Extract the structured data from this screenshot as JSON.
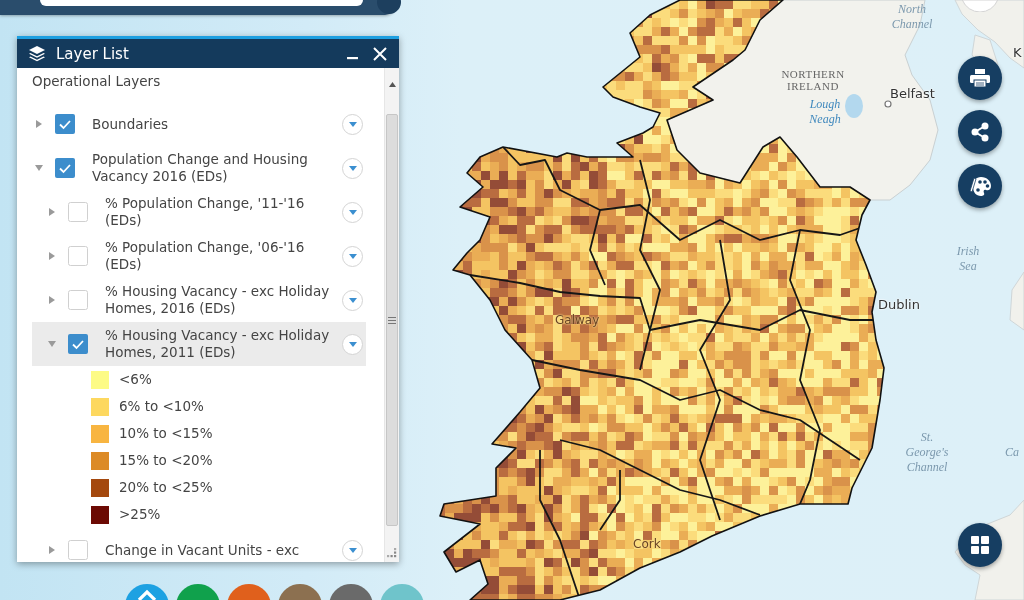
{
  "layer_list": {
    "title": "Layer List",
    "section_heading": "Operational Layers",
    "layers": [
      {
        "label": "Boundaries",
        "checked": true,
        "expanded": false,
        "selected": false
      },
      {
        "label": "Population Change and Housing Vacancy 2016 (EDs)",
        "checked": true,
        "expanded": true,
        "selected": false,
        "children": [
          {
            "label": "% Population Change, '11-'16 (EDs)",
            "checked": false,
            "expanded": false,
            "selected": false
          },
          {
            "label": "% Population Change, '06-'16 (EDs)",
            "checked": false,
            "expanded": false,
            "selected": false
          },
          {
            "label": "% Housing Vacancy - exc Holiday Homes, 2016 (EDs)",
            "checked": false,
            "expanded": false,
            "selected": false
          },
          {
            "label": "% Housing Vacancy - exc Holiday Homes, 2011 (EDs)",
            "checked": true,
            "expanded": true,
            "selected": true,
            "legend": [
              {
                "label": "<6%",
                "color": "#fdfb86"
              },
              {
                "label": "6% to <10%",
                "color": "#fdd85f"
              },
              {
                "label": "10% to <15%",
                "color": "#f8b541"
              },
              {
                "label": "15% to <20%",
                "color": "#dc8a26"
              },
              {
                "label": "20% to <25%",
                "color": "#a4480e"
              },
              {
                "label": ">25%",
                "color": "#6c0a03"
              }
            ]
          },
          {
            "label": "Change in Vacant Units - exc",
            "checked": false,
            "expanded": false,
            "selected": false
          }
        ]
      }
    ]
  },
  "map_labels": [
    {
      "text": "North Channel",
      "kind": "sea"
    },
    {
      "text": "NORTHERN IRELAND",
      "kind": "region"
    },
    {
      "text": "Lough Neagh",
      "kind": "lake"
    },
    {
      "text": "Belfast",
      "kind": "city"
    },
    {
      "text": "Irish Sea",
      "kind": "sea"
    },
    {
      "text": "Dublin",
      "kind": "city"
    },
    {
      "text": "St. George's Channel",
      "kind": "sea"
    },
    {
      "text": "K",
      "kind": "city"
    },
    {
      "text": "Ca",
      "kind": "sea"
    },
    {
      "text": "Galway",
      "kind": "town"
    },
    {
      "text": "Cork",
      "kind": "town"
    }
  ],
  "app_buttons": [
    {
      "color": "#1da1e2",
      "kind": "icon"
    },
    {
      "color": "#10a14c",
      "kind": "plain"
    },
    {
      "color": "#e0601c",
      "kind": "plain"
    },
    {
      "color": "#8c7050",
      "kind": "plain"
    },
    {
      "color": "#6a6a6a",
      "kind": "plain"
    },
    {
      "color": "#6fc4cb",
      "kind": "plain"
    }
  ]
}
